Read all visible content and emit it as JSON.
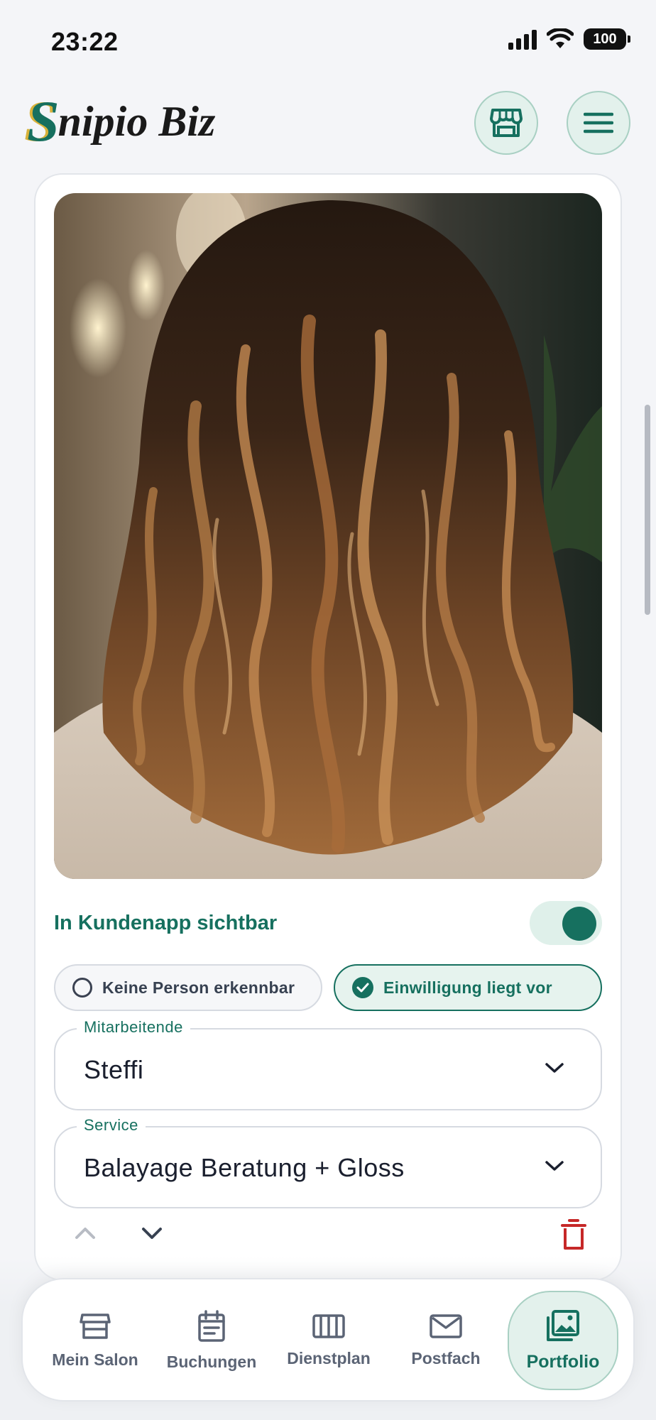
{
  "status_bar": {
    "time": "23:22",
    "battery": "100"
  },
  "header": {
    "logo_initial": "S",
    "logo_text": "nipio Biz",
    "shop_icon": "storefront-icon",
    "menu_icon": "hamburger-menu-icon"
  },
  "card": {
    "photo_icon": "hair-photo",
    "visibility_label": "In Kundenapp sichtbar",
    "visibility_on": true,
    "chip_no_person": "Keine Person erkennbar",
    "chip_consent": "Einwilligung liegt vor",
    "employee_label": "Mitarbeitende",
    "employee_value": "Steffi",
    "service_label": "Service",
    "service_value": "Balayage Beratung + Gloss"
  },
  "nav": {
    "items": [
      {
        "label": "Mein Salon",
        "icon": "store-icon"
      },
      {
        "label": "Buchungen",
        "icon": "calendar-icon"
      },
      {
        "label": "Dienstplan",
        "icon": "schedule-columns-icon"
      },
      {
        "label": "Postfach",
        "icon": "mail-icon"
      },
      {
        "label": "Portfolio",
        "icon": "gallery-icon"
      }
    ],
    "active": "Portfolio"
  },
  "colors": {
    "accent": "#16705f",
    "accent_light": "#e3f1ec",
    "danger": "#c62828",
    "background": "#f4f5f8"
  }
}
